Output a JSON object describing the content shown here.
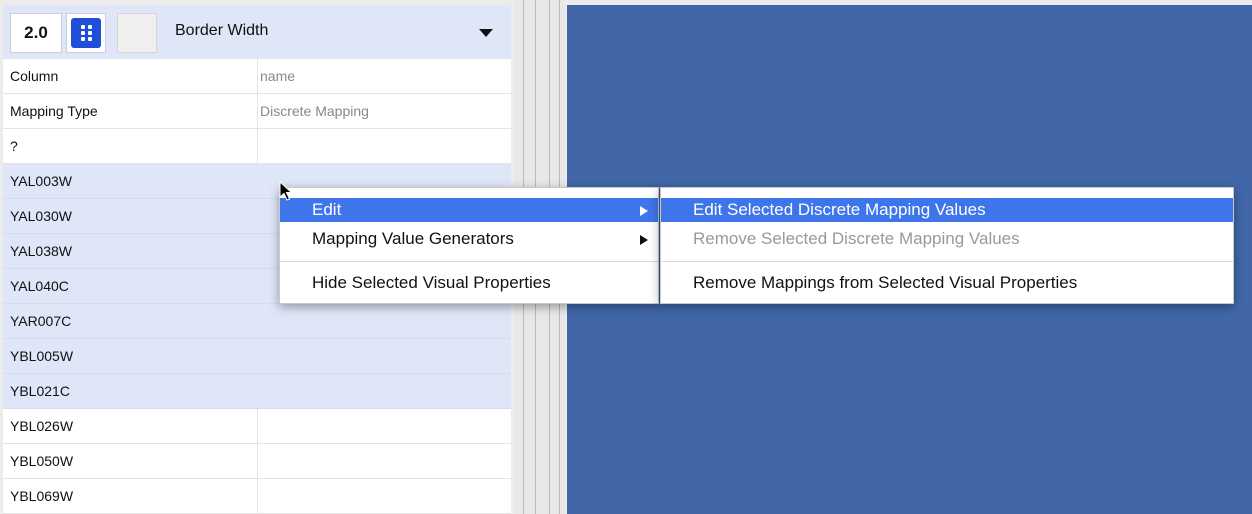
{
  "visual_property": {
    "value": "2.0",
    "name": "Border Width",
    "mapping_icon": "discrete-mapping-icon",
    "dropdown_icon": "triangle-down-icon"
  },
  "properties": [
    {
      "key": "Column",
      "value": "name"
    },
    {
      "key": "Mapping Type",
      "value": "Discrete Mapping"
    },
    {
      "key": "?",
      "value": ""
    }
  ],
  "mapping_rows": [
    {
      "key": "YAL003W",
      "value": "",
      "selected": true
    },
    {
      "key": "YAL030W",
      "value": "",
      "selected": true
    },
    {
      "key": "YAL038W",
      "value": "",
      "selected": true
    },
    {
      "key": "YAL040C",
      "value": "",
      "selected": true
    },
    {
      "key": "YAR007C",
      "value": "",
      "selected": true
    },
    {
      "key": "YBL005W",
      "value": "",
      "selected": true
    },
    {
      "key": "YBL021C",
      "value": "",
      "selected": true
    },
    {
      "key": "YBL026W",
      "value": "",
      "selected": false
    },
    {
      "key": "YBL050W",
      "value": "",
      "selected": false
    },
    {
      "key": "YBL069W",
      "value": "",
      "selected": false
    }
  ],
  "context_menu": {
    "items": [
      {
        "label": "Edit",
        "submenu": true,
        "highlighted": true
      },
      {
        "label": "Mapping Value Generators",
        "submenu": true,
        "highlighted": false
      },
      {
        "label": "Hide Selected Visual Properties",
        "submenu": false,
        "highlighted": false
      }
    ]
  },
  "submenu": {
    "items": [
      {
        "label": "Edit Selected Discrete Mapping Values",
        "highlighted": true,
        "enabled": true
      },
      {
        "label": "Remove Selected Discrete Mapping Values",
        "highlighted": false,
        "enabled": false
      },
      {
        "label": "Remove Mappings from Selected Visual Properties",
        "highlighted": false,
        "enabled": true
      }
    ]
  },
  "colors": {
    "network_background": "#4167a9",
    "selection": "#dfe6f8",
    "menu_highlight": "#3e75ea",
    "mapping_icon": "#1f4fd8"
  }
}
